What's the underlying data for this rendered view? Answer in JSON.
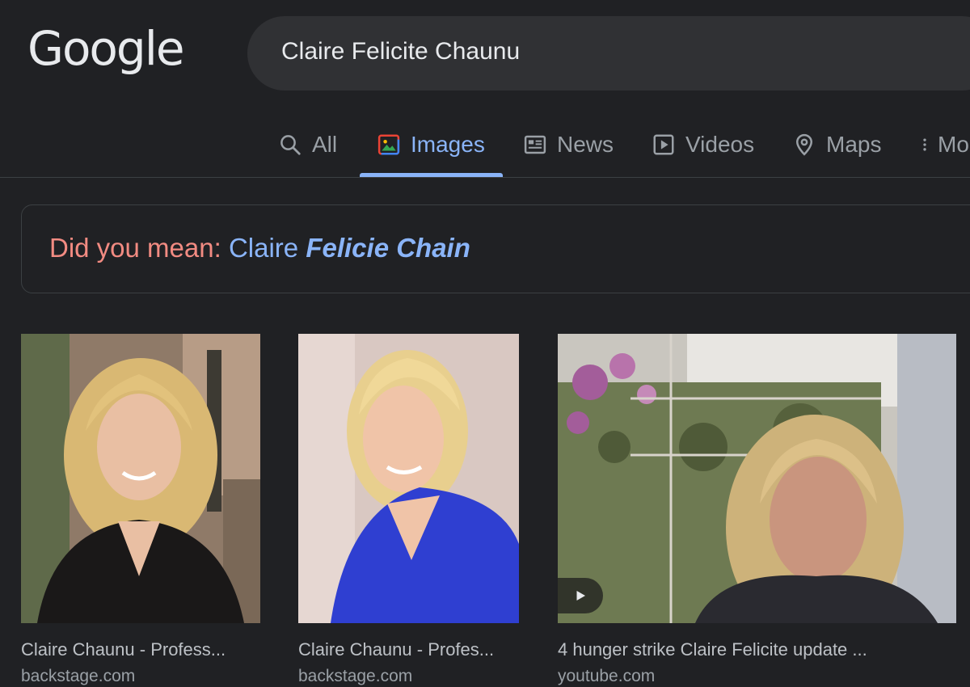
{
  "header": {
    "logo_text": "Google",
    "search_query": "Claire Felicite Chaunu"
  },
  "tabs": [
    {
      "label": "All",
      "icon": "search-icon"
    },
    {
      "label": "Images",
      "icon": "image-icon",
      "active": true
    },
    {
      "label": "News",
      "icon": "news-icon"
    },
    {
      "label": "Videos",
      "icon": "video-icon"
    },
    {
      "label": "Maps",
      "icon": "map-pin-icon"
    },
    {
      "label": "Mo",
      "icon": "more-vert-icon"
    }
  ],
  "did_you_mean": {
    "prefix": "Did you mean:",
    "plain": "Claire",
    "emphasis": "Felicie Chain"
  },
  "results": [
    {
      "caption": "Claire Chaunu - Profess...",
      "source": "backstage.com"
    },
    {
      "caption": "Claire Chaunu - Profes...",
      "source": "backstage.com"
    },
    {
      "caption": "4 hunger strike Claire Felicite update ...",
      "source": "youtube.com",
      "has_play": true
    }
  ],
  "colors": {
    "background": "#202124",
    "accent": "#8ab4f8",
    "suggestion_prefix": "#f28b82"
  }
}
